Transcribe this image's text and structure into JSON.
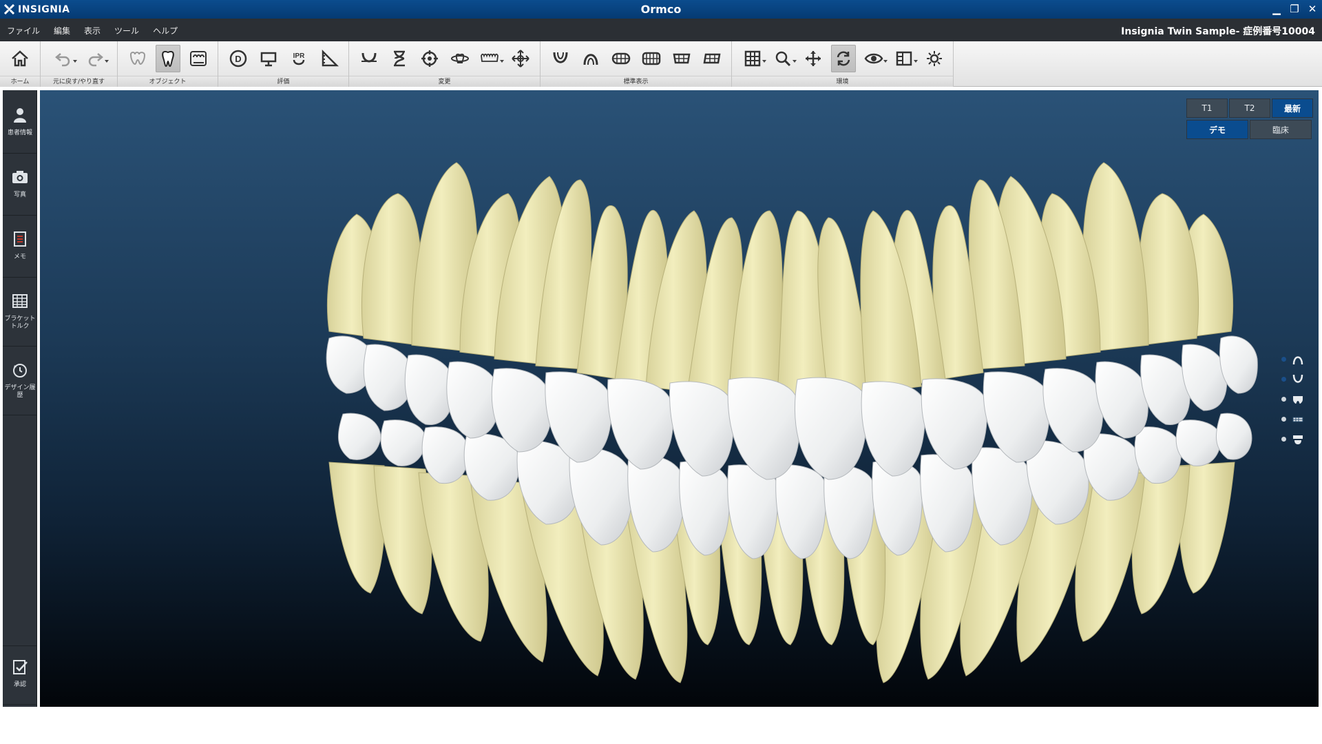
{
  "title_bar": {
    "brand": "INSIGNIA",
    "title": "Ormco",
    "controls": {
      "minimize": "▁",
      "restore": "❐",
      "close": "✕"
    }
  },
  "menu": {
    "items": [
      "ファイル",
      "編集",
      "表示",
      "ツール",
      "ヘルプ"
    ],
    "case_info": "Insignia Twin Sample- 症例番号10004"
  },
  "toolbar": {
    "groups": [
      {
        "label": "ホーム"
      },
      {
        "label": "元に戻す/やり直す"
      },
      {
        "label": "オブジェクト"
      },
      {
        "label": "評価"
      },
      {
        "label": "変更"
      },
      {
        "label": "標準表示"
      },
      {
        "label": "環境"
      }
    ],
    "ipr_text": "IPR",
    "d_text": "D"
  },
  "sidebar": {
    "items": [
      {
        "label": "患者情報",
        "icon": "person-icon"
      },
      {
        "label": "写真",
        "icon": "camera-icon"
      },
      {
        "label": "メモ",
        "icon": "memo-icon"
      },
      {
        "label": "ブラケットトルク",
        "icon": "table-icon"
      },
      {
        "label": "デザイン履歴",
        "icon": "history-icon"
      },
      {
        "label": "承認",
        "icon": "approve-icon"
      }
    ]
  },
  "viewport": {
    "time_buttons": [
      {
        "label": "T1",
        "selected": false
      },
      {
        "label": "T2",
        "selected": false
      },
      {
        "label": "最新",
        "selected": true
      }
    ],
    "mode_buttons": [
      {
        "label": "デモ",
        "selected": true
      },
      {
        "label": "臨床",
        "selected": false
      }
    ]
  },
  "colors": {
    "title_blue": "#0a4c8f",
    "crown_white": "#f1f2f3",
    "root_yellow": "#e5e0aa",
    "viewport_top": "#2a5277",
    "viewport_bottom": "#020509"
  }
}
